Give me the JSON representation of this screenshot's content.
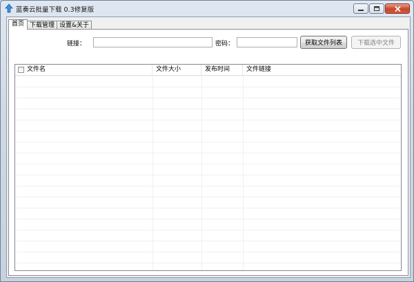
{
  "window": {
    "title": "蓝奏云批量下载 0.3修复版",
    "icon": "upload-arrow-icon",
    "buttons": [
      "minimize-icon",
      "maximize-icon",
      "close-icon"
    ]
  },
  "tabs": [
    {
      "label": "首页",
      "active": true
    },
    {
      "label": "下载管理",
      "active": false
    },
    {
      "label": "设置&关于",
      "active": false
    }
  ],
  "form": {
    "link_label": "链接：",
    "link_value": "",
    "password_label": "密码：",
    "password_value": "",
    "fetch_button": "获取文件列表",
    "download_button": "下载选中文件"
  },
  "table": {
    "columns": [
      "文件名",
      "文件大小",
      "发布时间",
      "文件链接"
    ],
    "rows": []
  }
}
